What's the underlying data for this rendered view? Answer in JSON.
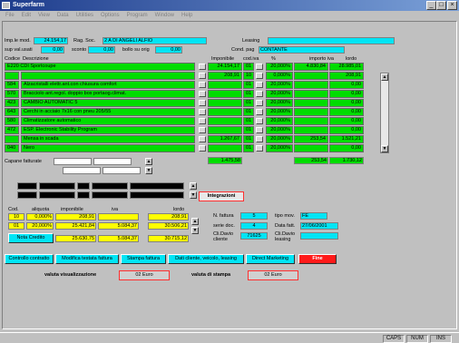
{
  "window": {
    "title": "Superfarm",
    "minimize": "_",
    "maximize": "□",
    "close": "×"
  },
  "menu": [
    "File",
    "Edit",
    "View",
    "Data",
    "Utilities",
    "Options",
    "Program",
    "Window",
    "Help"
  ],
  "header": {
    "imp_label": "Imp.le mod.",
    "imp_value": "24.154,17",
    "rag_label": "Rag. Soc.",
    "rag_value": "2 A DI ANGELI ALFIO",
    "leasing_label": "Leasing",
    "leasing_value": "",
    "sup_label": "sup val.usati",
    "sup_value": "0,00",
    "sconto_label": "sconto",
    "sconto_value": "0,00",
    "bollo_label": "bollo su orig",
    "bollo_value": "0,00",
    "cond_label": "Cond. pag",
    "cond_value": "CONTANTE"
  },
  "table": {
    "headers": {
      "codice": "Codice",
      "descrizione": "Descrizione",
      "imponibile": "Imponibile",
      "codiva": "cod.iva",
      "pct": "%",
      "importo_iva": "importo iva",
      "lordo": "lordo"
    },
    "rows": [
      {
        "codice": "E220 CDI Sportcoupe",
        "descrizione": "",
        "imponibile": "24.154,17",
        "codiva": "01",
        "pct": "20,000%",
        "iva": "4.830,84",
        "lordo": "28.985,01"
      },
      {
        "codice": "",
        "descrizione": "",
        "imponibile": "208,91",
        "codiva": "10",
        "pct": "0,000%",
        "iva": "",
        "lordo": "208,91"
      },
      {
        "codice": "584",
        "descrizione": "Alzacristalli elettr.ant.con chiusura comfort",
        "imponibile": "",
        "codiva": "01",
        "pct": "20,000%",
        "iva": "",
        "lordo": "0,00"
      },
      {
        "codice": "570",
        "descrizione": "Bracciolo ant.regol. doppio box portaog.climat.",
        "imponibile": "",
        "codiva": "01",
        "pct": "20,000%",
        "iva": "",
        "lordo": "0,00"
      },
      {
        "codice": "423",
        "descrizione": "CAMBIO AUTOMATIC 5",
        "imponibile": "",
        "codiva": "01",
        "pct": "20,000%",
        "iva": "",
        "lordo": "0,00"
      },
      {
        "codice": "643",
        "descrizione": "Cerchi in acciaio 7x16 con pneu 205/55",
        "imponibile": "",
        "codiva": "01",
        "pct": "20,000%",
        "iva": "",
        "lordo": "0,00"
      },
      {
        "codice": "580",
        "descrizione": "Climatizzatore automatico",
        "imponibile": "",
        "codiva": "01",
        "pct": "20,000%",
        "iva": "",
        "lordo": "0,00"
      },
      {
        "codice": "472",
        "descrizione": "ESP. Electronic Stability Program",
        "imponibile": "",
        "codiva": "01",
        "pct": "20,000%",
        "iva": "",
        "lordo": "0,00"
      },
      {
        "codice": "",
        "descrizione": "Mensa in scada",
        "imponibile": "1.267,67",
        "codiva": "01",
        "pct": "20,000%",
        "iva": "253,54",
        "lordo": "1.521,21"
      },
      {
        "codice": "040",
        "descrizione": "Nero",
        "imponibile": "",
        "codiva": "01",
        "pct": "20,000%",
        "iva": "",
        "lordo": "0,00"
      }
    ],
    "totals": {
      "imponibile": "1.475,58",
      "iva": "253,54",
      "lordo": "1.730,12"
    }
  },
  "capane_label": "Capane fatturate",
  "integrazioni": "Integrazioni",
  "iva_summary": {
    "headers": {
      "cod": "Cod.",
      "aliquota": "aliquota",
      "imponibile": "imponibile",
      "iva": "iva",
      "lordo": "lordo"
    },
    "rows": [
      {
        "cod": "10",
        "aliquota": "0,000%",
        "imponibile": "208,91",
        "iva": "",
        "lordo": "208,91"
      },
      {
        "cod": "01",
        "aliquota": "20,000%",
        "imponibile": "25.421,84",
        "iva": "5.084,37",
        "lordo": "30.506,21"
      }
    ],
    "nota_credito": "Nota Credito",
    "total_imponibile": "25.630,75",
    "total_iva": "5.084,37",
    "total_lordo": "30.715,12"
  },
  "invoice": {
    "nfatt_label": "N. fattura",
    "nfatt_value": "5",
    "tipo_label": "tipo mov.",
    "tipo_value": "FE",
    "serie_label": "serie doc.",
    "serie_value": "4",
    "data_label": "Data fatt.",
    "data_value": "27/06/2001",
    "cld_cliente_label": "Cli.Davio cliente",
    "cld_cliente_value": "71625",
    "cld_leasing_label": "Cli.Davio leasing",
    "cld_leasing_value": ""
  },
  "buttons": [
    "Controllo contratto",
    "Modifica testata fattura",
    "Stampa fattura",
    "Dati cliente, veicolo, leasing",
    "Direct Marketing",
    "Fine"
  ],
  "valuta": {
    "vis_label": "valuta visualizzazione",
    "vis_value": "02 Euro",
    "stampa_label": "valuta di stampa",
    "stampa_value": "02 Euro"
  },
  "status": [
    "CAPS",
    "NUM",
    "INS"
  ],
  "colors": {
    "field": "#00e5f5",
    "row": "#00dd00",
    "yellow": "#ffff00",
    "fine": "#ff1a1a"
  }
}
